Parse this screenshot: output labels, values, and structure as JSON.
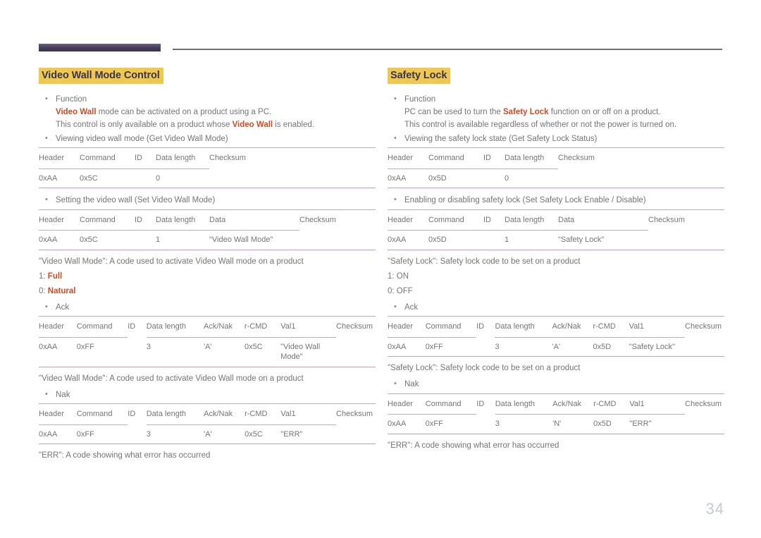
{
  "page": {
    "number": "34"
  },
  "left": {
    "title": "Video Wall Mode Control",
    "function_label": "Function",
    "function_line1_a": "Video Wall",
    "function_line1_b": " mode can be activated on a product using a PC.",
    "function_line2_a": "This control is only available on a product whose ",
    "function_line2_b": "Video Wall",
    "function_line2_c": " is enabled.",
    "get_bullet": "Viewing video wall mode (Get Video Wall Mode)",
    "get_table": {
      "headers": [
        "Header",
        "Command",
        "ID",
        "Data length",
        "Checksum"
      ],
      "rows": [
        [
          "0xAA",
          "0x5C",
          "",
          "0",
          ""
        ]
      ]
    },
    "set_bullet": "Setting the video wall (Set Video Wall Mode)",
    "set_table": {
      "headers": [
        "Header",
        "Command",
        "ID",
        "Data length",
        "Data",
        "Checksum"
      ],
      "rows": [
        [
          "0xAA",
          "0x5C",
          "",
          "1",
          "\"Video Wall Mode\"",
          ""
        ]
      ]
    },
    "note_mode": "\"Video Wall Mode\": A code used to activate Video Wall mode on a product",
    "opt1_prefix": "1: ",
    "opt1_value": "Full",
    "opt0_prefix": "0: ",
    "opt0_value": "Natural",
    "ack_bullet": "Ack",
    "ack_table": {
      "headers": [
        "Header",
        "Command",
        "ID",
        "Data length",
        "Ack/Nak",
        "r-CMD",
        "Val1",
        "Checksum"
      ],
      "rows": [
        [
          "0xAA",
          "0xFF",
          "",
          "3",
          "'A'",
          "0x5C",
          "\"Video Wall Mode\"",
          ""
        ]
      ]
    },
    "note_mode2": "\"Video Wall Mode\": A code used to activate Video Wall mode on a product",
    "nak_bullet": "Nak",
    "nak_table": {
      "headers": [
        "Header",
        "Command",
        "ID",
        "Data length",
        "Ack/Nak",
        "r-CMD",
        "Val1",
        "Checksum"
      ],
      "rows": [
        [
          "0xAA",
          "0xFF",
          "",
          "3",
          "'A'",
          "0x5C",
          "\"ERR\"",
          ""
        ]
      ]
    },
    "note_err": "\"ERR\": A code showing what error has occurred"
  },
  "right": {
    "title": "Safety Lock",
    "function_label": "Function",
    "function_line1_a": "PC can be used to turn the ",
    "function_line1_b": "Safety Lock",
    "function_line1_c": " function on or off on a product.",
    "function_line2": "This control is available regardless of whether or not the power is turned on.",
    "get_bullet": "Viewing the safety lock state (Get Safety Lock Status)",
    "get_table": {
      "headers": [
        "Header",
        "Command",
        "ID",
        "Data length",
        "Checksum"
      ],
      "rows": [
        [
          "0xAA",
          "0x5D",
          "",
          "0",
          ""
        ]
      ]
    },
    "set_bullet": "Enabling or disabling safety lock (Set Safety Lock Enable / Disable)",
    "set_table": {
      "headers": [
        "Header",
        "Command",
        "ID",
        "Data length",
        "Data",
        "Checksum"
      ],
      "rows": [
        [
          "0xAA",
          "0x5D",
          "",
          "1",
          "\"Safety Lock\"",
          ""
        ]
      ]
    },
    "note_lock": "\"Safety Lock\": Safety lock code to be set on a product",
    "opt1": "1: ON",
    "opt0": "0: OFF",
    "ack_bullet": "Ack",
    "ack_table": {
      "headers": [
        "Header",
        "Command",
        "ID",
        "Data length",
        "Ack/Nak",
        "r-CMD",
        "Val1",
        "Checksum"
      ],
      "rows": [
        [
          "0xAA",
          "0xFF",
          "",
          "3",
          "'A'",
          "0x5D",
          "\"Safety Lock\"",
          ""
        ]
      ]
    },
    "note_lock2": "\"Safety Lock\": Safety lock code to be set on a product",
    "nak_bullet": "Nak",
    "nak_table": {
      "headers": [
        "Header",
        "Command",
        "ID",
        "Data length",
        "Ack/Nak",
        "r-CMD",
        "Val1",
        "Checksum"
      ],
      "rows": [
        [
          "0xAA",
          "0xFF",
          "",
          "3",
          "'N'",
          "0x5D",
          "\"ERR\"",
          ""
        ]
      ]
    },
    "note_err": "\"ERR\": A code showing what error has occurred"
  },
  "colors": {
    "highlight_bg": "#efc94f",
    "title_text": "#3b3350",
    "accent_orange": "#d04b24",
    "rule_dark": "#433a57",
    "table_bottom": "#c79dc7",
    "page_number": "#c3cad3"
  }
}
